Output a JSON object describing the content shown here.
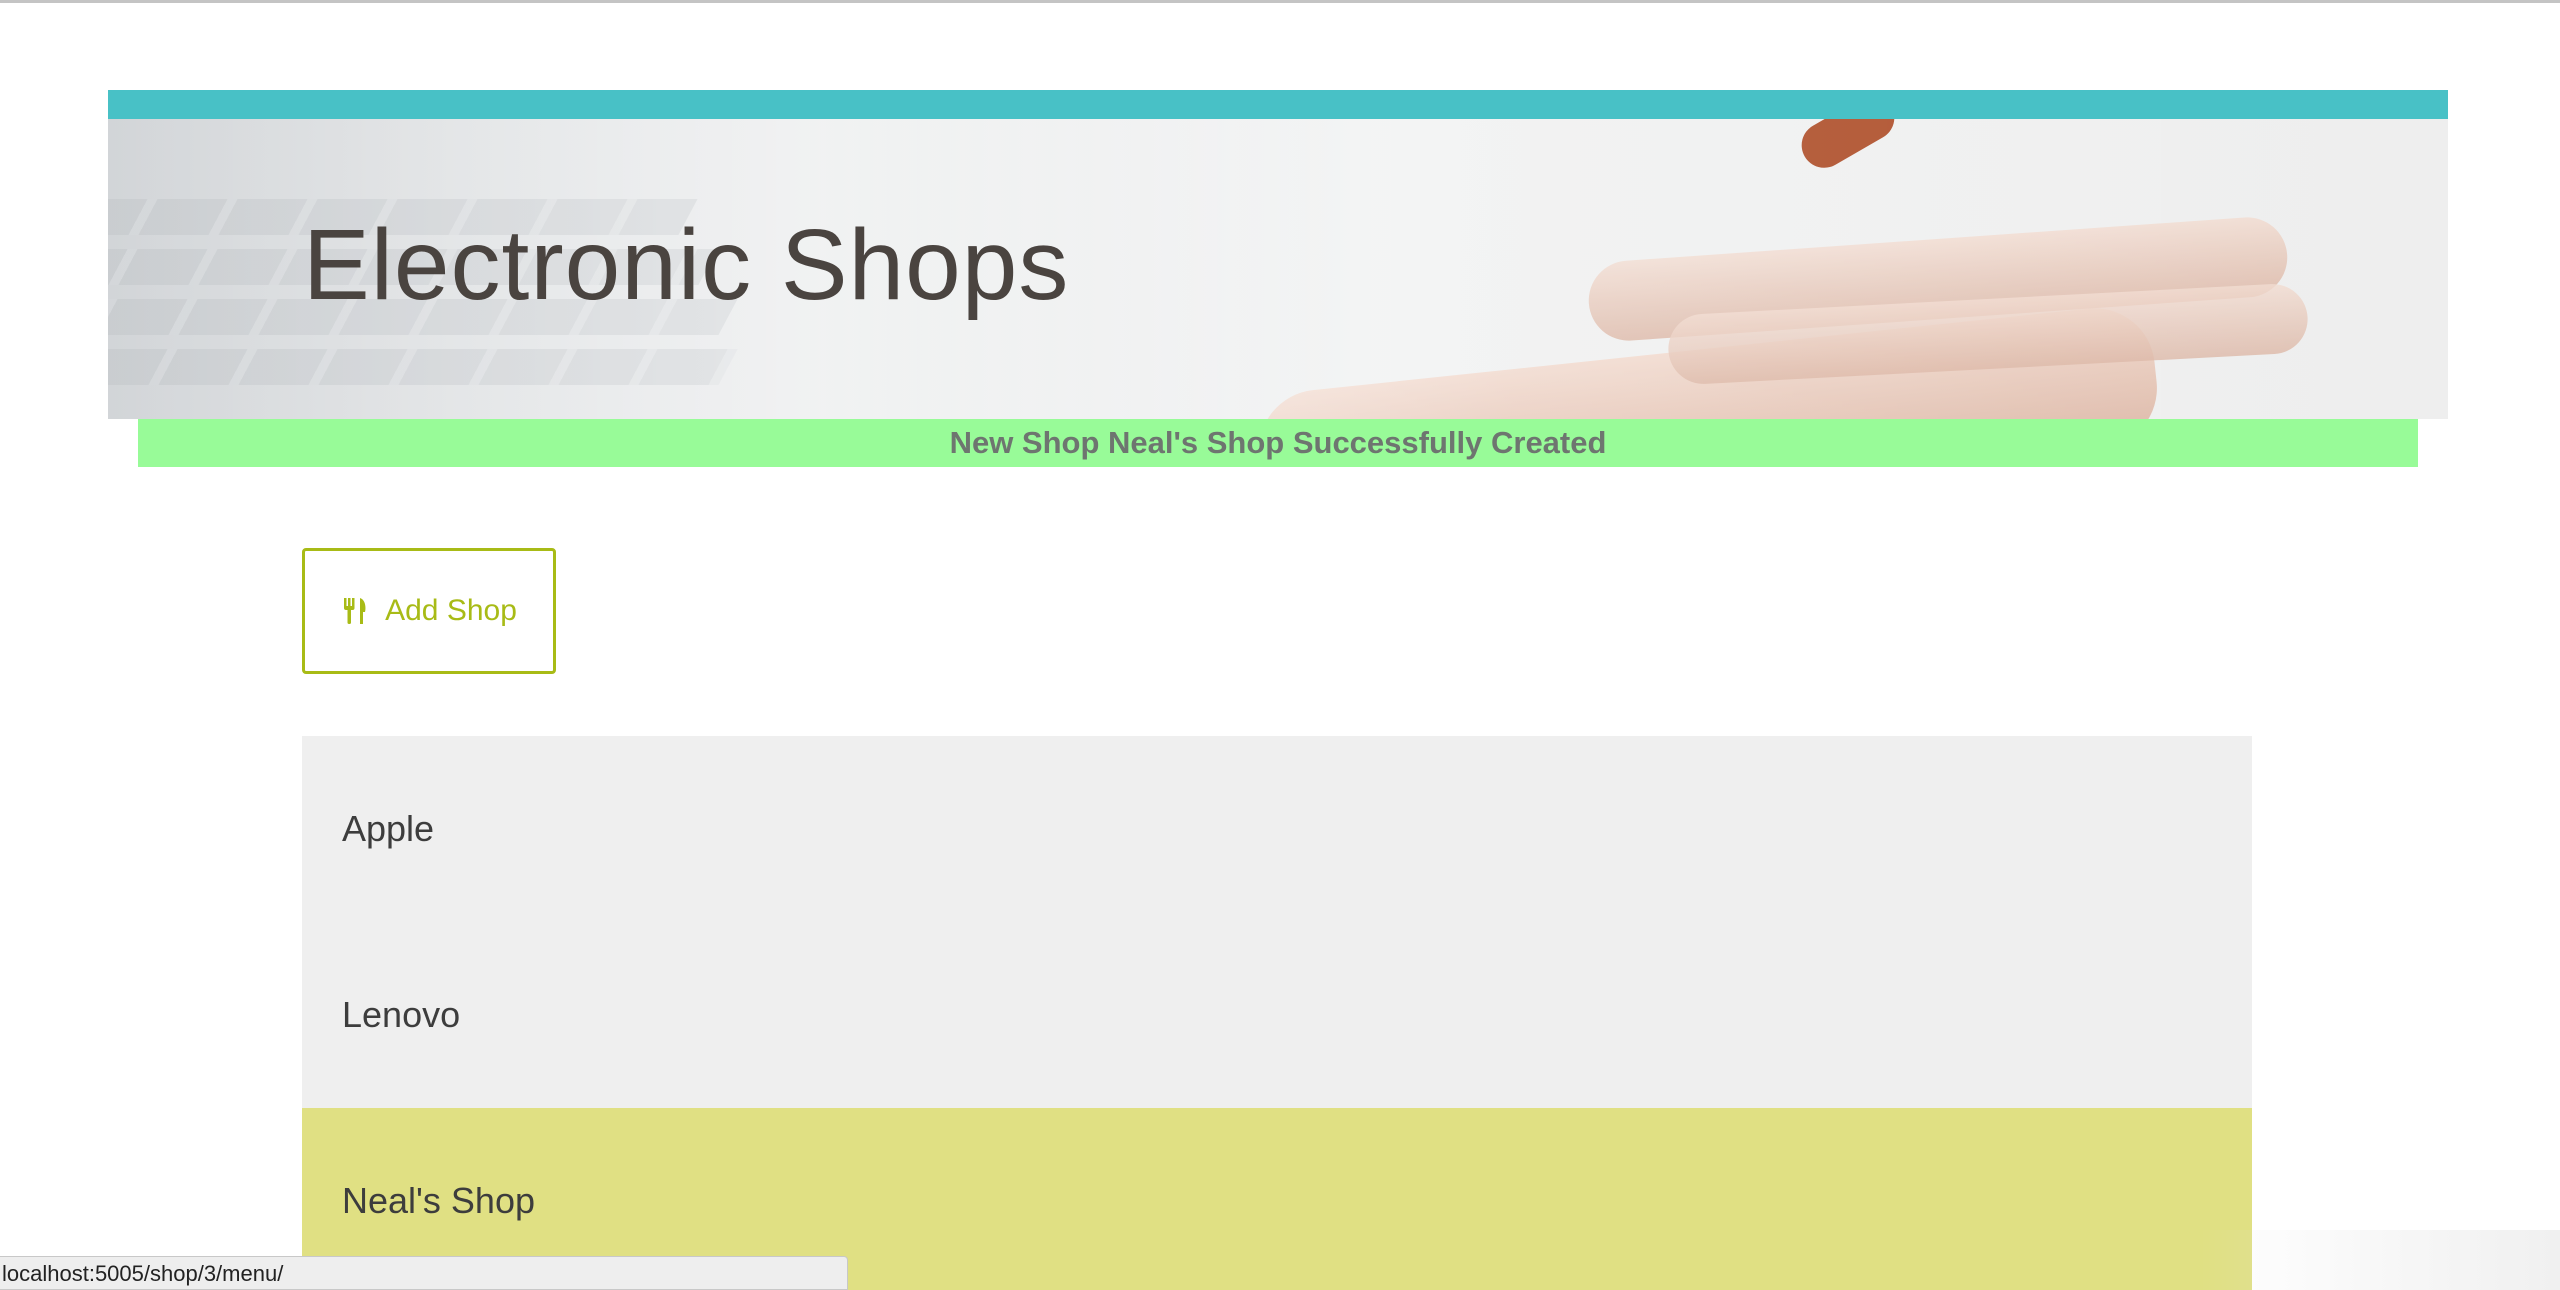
{
  "header": {
    "title": "Electronic Shops",
    "accent_color": "#48c1c6"
  },
  "flash": {
    "message": "New Shop Neal's Shop Successfully Created",
    "background_color": "#98fb98"
  },
  "actions": {
    "add_shop_label": "Add Shop",
    "add_shop_icon": "cutlery-icon",
    "accent_color": "#a8bb16"
  },
  "shops": [
    {
      "name": "Apple",
      "active": false
    },
    {
      "name": "Lenovo",
      "active": false
    },
    {
      "name": "Neal's Shop",
      "active": true
    }
  ],
  "status_bar": {
    "url": "localhost:5005/shop/3/menu/"
  }
}
